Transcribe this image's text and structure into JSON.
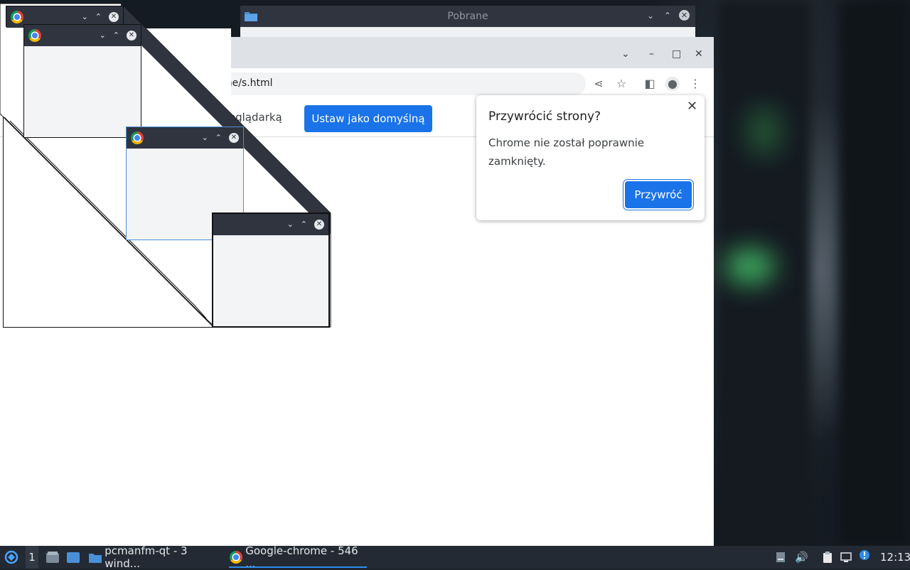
{
  "file_manager": {
    "title": "Pobrane",
    "buttons": [
      "chevron-down",
      "chevron-up",
      "close"
    ]
  },
  "chrome": {
    "new_tab": "+",
    "address": "Pobrane/s.html",
    "infobar": {
      "text": "zeglądarką",
      "button": "Ustaw jako domyślną"
    },
    "window_controls": {
      "tab_list": "⌄",
      "minimize": "–",
      "maximize": "□",
      "close": "✕"
    }
  },
  "restore_bubble": {
    "title": "Przywrócić strony?",
    "body": "Chrome nie został poprawnie zamknięty.",
    "button": "Przywróć",
    "close": "✕"
  },
  "taskbar": {
    "workspace": "1",
    "tasks": [
      {
        "label": "pcmanfm-qt - 3 wind...",
        "icon": "folder-icon",
        "active": false
      },
      {
        "label": "Google-chrome - 546 ...",
        "icon": "chrome-icon",
        "active": true
      }
    ],
    "clock": "12:13"
  },
  "colors": {
    "accent": "#1a73e8",
    "titlebar": "#2f343f",
    "taskbar": "#232a33",
    "tabstrip": "#dee1e6"
  }
}
